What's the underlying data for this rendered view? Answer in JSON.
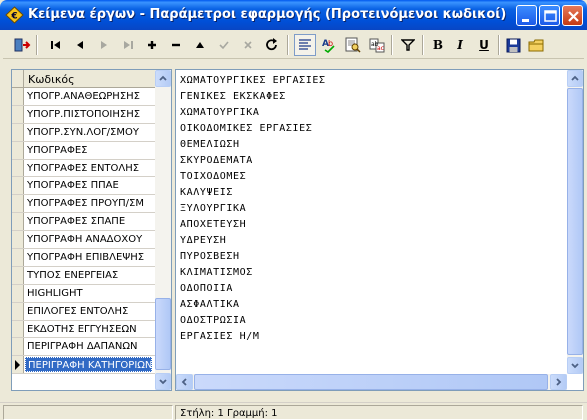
{
  "window": {
    "title": "Κείμενα έργων - Παράμετροι εφαρμογής (Προτεινόμενοι κωδικοί)"
  },
  "toolbar": {
    "icons": [
      "exit-icon",
      "first-record-icon",
      "prior-record-icon",
      "next-record-icon",
      "last-record-icon",
      "insert-icon",
      "delete-icon",
      "edit-icon",
      "post-icon",
      "cancel-icon",
      "refresh-icon",
      "text-align-icon",
      "spell-check-icon",
      "find-icon",
      "replace-icon",
      "filter-icon",
      "bold-icon",
      "italic-icon",
      "underline-icon",
      "save-icon",
      "open-icon"
    ],
    "bold_label": "B",
    "italic_label": "I",
    "underline_label": "U"
  },
  "grid": {
    "column_header": "Κωδικός",
    "rows": [
      "ΥΠΟΓΡ.ΑΝΑΘΕΩΡΗΣΗΣ",
      "ΥΠΟΓΡ.ΠΙΣΤΟΠΟΙΗΣΗΣ",
      "ΥΠΟΓΡ.ΣΥΝ.ΛΟΓ/ΣΜΟΥ",
      "ΥΠΟΓΡΑΦΕΣ",
      "ΥΠΟΓΡΑΦΕΣ ΕΝΤΟΛΗΣ",
      "ΥΠΟΓΡΑΦΕΣ ΠΠΑΕ",
      "ΥΠΟΓΡΑΦΕΣ ΠΡΟΥΠ/ΣΜ",
      "ΥΠΟΓΡΑΦΕΣ ΣΠΑΠΕ",
      "ΥΠΟΓΡΑΦΗ ΑΝΑΔΟΧΟΥ",
      "ΥΠΟΓΡΑΦΗ ΕΠΙΒΛΕΨΗΣ",
      "ΤΥΠΟΣ ΕΝΕΡΓΕΙΑΣ",
      "HIGHLIGHT",
      "ΕΠΙΛΟΓΕΣ ΕΝΤΟΛΗΣ",
      "ΕΚΔΟΤΗΣ ΕΓΓΥΗΣΕΩΝ",
      "ΠΕΡΙΓΡΑΦΗ ΔΑΠΑΝΩΝ",
      "ΠΕΡΙΓΡΑΦΗ ΚΑΤΗΓΟΡΙΩΝ"
    ],
    "selected_index": 15
  },
  "memo": {
    "lines": [
      "ΧΩΜΑΤΟΥΡΓΙΚΕΣ ΕΡΓΑΣΙΕΣ",
      "ΓΕΝΙΚΕΣ ΕΚΣΚΑΦΕΣ",
      "ΧΩΜΑΤΟΥΡΓΙΚΑ",
      "ΟΙΚΟΔΟΜΙΚΕΣ ΕΡΓΑΣΙΕΣ",
      "ΘΕΜΕΛΙΩΣΗ",
      "ΣΚΥΡΟΔΕΜΑΤΑ",
      "ΤΟΙΧΟΔΟΜΕΣ",
      "ΚΑΛΥΨΕΙΣ",
      "ΞΥΛΟΥΡΓΙΚΑ",
      "ΑΠΟΧΕΤΕΥΣΗ",
      "ΥΔΡΕΥΣΗ",
      "ΠΥΡΟΣΒΕΣΗ",
      "ΚΛΙΜΑΤΙΣΜΟΣ",
      "ΟΔΟΠΟΙΙΑ",
      "ΑΣΦΑΛΤΙΚΑ",
      "ΟΔΟΣΤΡΩΣΙΑ",
      "ΕΡΓΑΣΙΕΣ Η/Μ"
    ]
  },
  "status": {
    "position": "Στήλη: 1  Γραμμή: 1"
  },
  "colors": {
    "titlebar": "#0a5fe0",
    "selection": "#316ac5",
    "face": "#ece9d8"
  }
}
